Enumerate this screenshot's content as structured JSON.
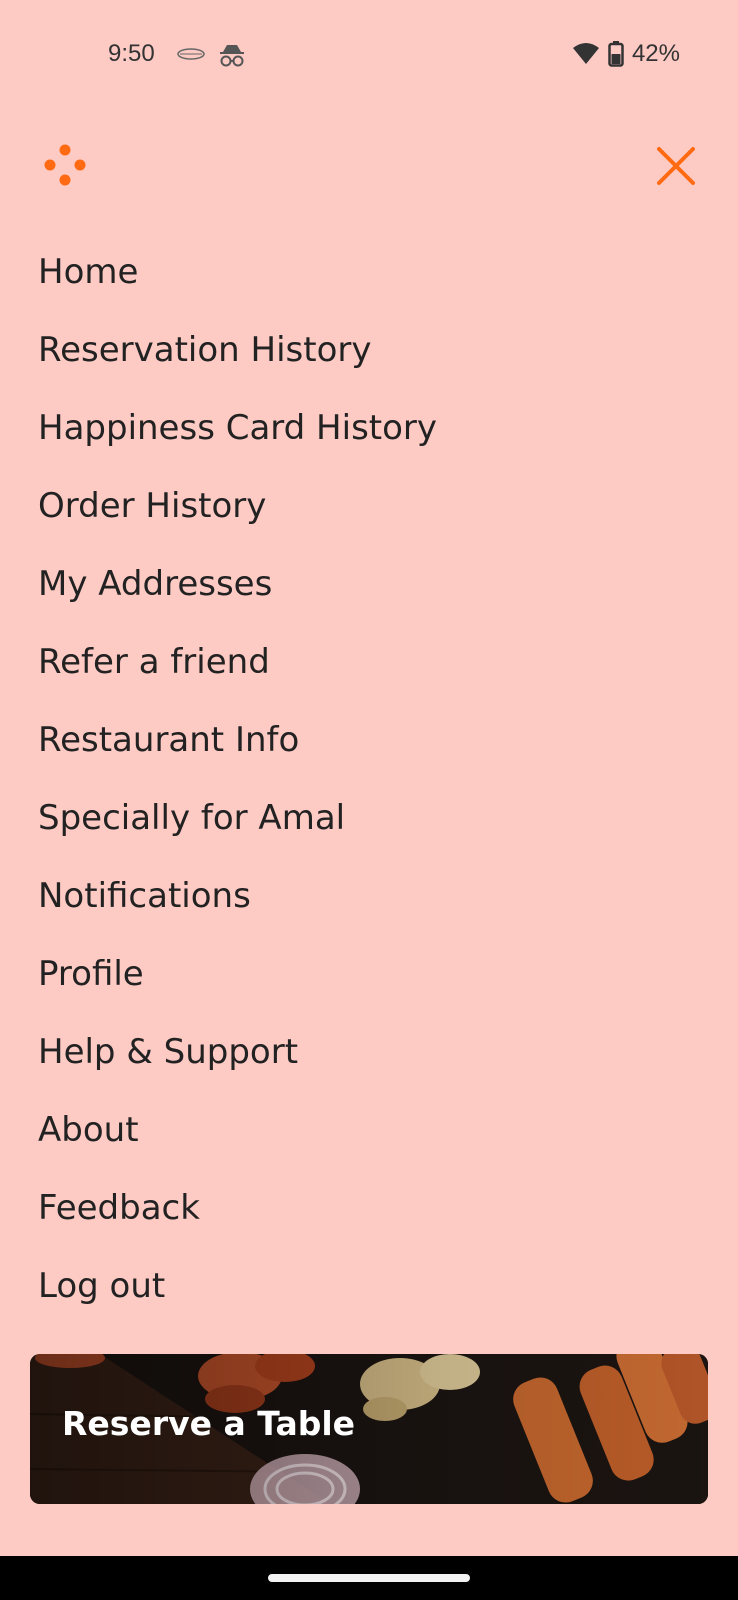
{
  "status_bar": {
    "time": "9:50",
    "battery": "42%",
    "icons": [
      "carrier-logo-icon",
      "incognito-icon",
      "wifi-icon",
      "battery-icon"
    ]
  },
  "header": {
    "logo_icon": "dots-logo-icon",
    "close_icon": "close-icon"
  },
  "menu": {
    "items": [
      "Home",
      "Reservation History",
      "Happiness Card History",
      "Order History",
      "My Addresses",
      "Refer a friend",
      "Restaurant Info",
      "Specially for Amal",
      "Notifications",
      "Profile",
      "Help & Support",
      "About",
      "Feedback",
      "Log out"
    ]
  },
  "banner": {
    "label": "Reserve a Table"
  },
  "colors": {
    "background": "#fdcac4",
    "accent": "#ff6a13",
    "text": "#222222"
  }
}
